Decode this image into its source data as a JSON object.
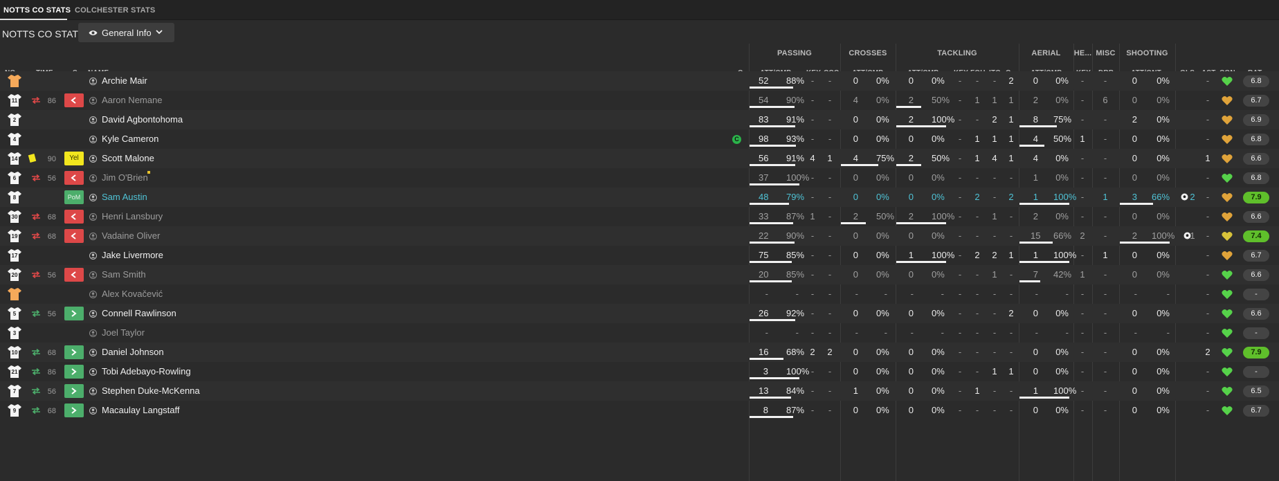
{
  "tabs": [
    {
      "label": "NOTTS CO STATS",
      "active": true
    },
    {
      "label": "COLCHESTER STATS",
      "active": false
    }
  ],
  "page_title": "NOTTS CO STATS",
  "view_selector": {
    "label": "General Info",
    "icon": "eye-icon"
  },
  "colors": {
    "sub_off": "#dd4848",
    "sub_on": "#4cae6b",
    "yellow_card": "#f2e61e",
    "pom": "#4cae6b",
    "highlight_name": "#4fc3d6",
    "rating_good": "#5fbf2b",
    "captain": "#2bb34a"
  },
  "group_headers": {
    "passing": "PASSING",
    "crosses": "CROSSES",
    "tackling": "TACKLING",
    "aerial": "AERIAL",
    "he": "HE...",
    "misc": "MISC",
    "shooting": "SHOOTING"
  },
  "columns": {
    "no": "NO.",
    "time": "TIME",
    "s": "S",
    "name": "NAME",
    "c": "C",
    "pass_att_cmp": "ATT/CMP",
    "key": "KEY",
    "ccc": "CCC",
    "cross_att_cmp": "ATT/CMP",
    "tackle_att_cmp": "ATT/CMP",
    "tackle_key": "KEY",
    "fou": "FOU",
    "itc": "ITC",
    "tackle_c": "C...",
    "aerial_att_cmp": "ATT/CMP",
    "he_key": "KEY",
    "drb": "DRB",
    "shots_att_ont": "ATT/ONT",
    "gls": "GLS",
    "ast": "AST",
    "con": "CON",
    "rat": "RAT"
  },
  "players": [
    {
      "no": "",
      "kit": "gk",
      "time": "",
      "sub": "",
      "status": "",
      "name": "Archie Mair",
      "dim": false,
      "captain": "",
      "pa": "52",
      "pp": "88%",
      "pfill": 0.88,
      "pk": "-",
      "pc": "-",
      "ca": "0",
      "cp": "0%",
      "cfill": 0,
      "ta": "0",
      "tp": "0%",
      "tfill": 0,
      "tk": "-",
      "fou": "-",
      "itc": "-",
      "tc": "2",
      "aa": "0",
      "ap": "0%",
      "afill": 0,
      "hk": "-",
      "drb": "-",
      "sa": "0",
      "sp": "0%",
      "sfill": 0,
      "gls": "",
      "ast": "-",
      "rat": "6.8",
      "good": false,
      "heart": "green"
    },
    {
      "no": "11",
      "kit": "out",
      "time": "86",
      "sub": "off",
      "status": "",
      "name": "Aaron Nemane",
      "dim": true,
      "captain": "",
      "pa": "54",
      "pp": "90%",
      "pfill": 0.9,
      "pk": "-",
      "pc": "-",
      "ca": "4",
      "cp": "0%",
      "cfill": 0,
      "ta": "2",
      "tp": "50%",
      "tfill": 0.5,
      "tk": "-",
      "fou": "1",
      "itc": "1",
      "tc": "1",
      "aa": "2",
      "ap": "0%",
      "afill": 0,
      "hk": "-",
      "drb": "6",
      "sa": "0",
      "sp": "0%",
      "sfill": 0,
      "gls": "",
      "ast": "-",
      "rat": "6.7",
      "good": false,
      "heart": "orange"
    },
    {
      "no": "2",
      "kit": "out",
      "time": "",
      "sub": "",
      "status": "",
      "name": "David Agbontohoma",
      "dim": false,
      "captain": "",
      "pa": "83",
      "pp": "91%",
      "pfill": 0.91,
      "pk": "-",
      "pc": "-",
      "ca": "0",
      "cp": "0%",
      "cfill": 0,
      "ta": "2",
      "tp": "100%",
      "tfill": 1,
      "tk": "-",
      "fou": "-",
      "itc": "2",
      "tc": "1",
      "aa": "8",
      "ap": "75%",
      "afill": 0.75,
      "hk": "-",
      "drb": "-",
      "sa": "2",
      "sp": "0%",
      "sfill": 0,
      "gls": "",
      "ast": "-",
      "rat": "6.9",
      "good": false,
      "heart": "orange"
    },
    {
      "no": "4",
      "kit": "out",
      "time": "",
      "sub": "",
      "status": "",
      "name": "Kyle Cameron",
      "dim": false,
      "captain": "C",
      "pa": "98",
      "pp": "93%",
      "pfill": 0.93,
      "pk": "-",
      "pc": "-",
      "ca": "0",
      "cp": "0%",
      "cfill": 0,
      "ta": "0",
      "tp": "0%",
      "tfill": 0,
      "tk": "-",
      "fou": "1",
      "itc": "1",
      "tc": "1",
      "aa": "4",
      "ap": "50%",
      "afill": 0.5,
      "hk": "1",
      "drb": "-",
      "sa": "0",
      "sp": "0%",
      "sfill": 0,
      "gls": "",
      "ast": "-",
      "rat": "6.8",
      "good": false,
      "heart": "orange"
    },
    {
      "no": "14",
      "kit": "out",
      "time": "90",
      "sub": "",
      "status": "Yel",
      "name": "Scott Malone",
      "dim": false,
      "captain": "",
      "pa": "56",
      "pp": "91%",
      "pfill": 0.91,
      "pk": "4",
      "pc": "1",
      "ca": "4",
      "cp": "75%",
      "cfill": 0.75,
      "ta": "2",
      "tp": "50%",
      "tfill": 0.5,
      "tk": "-",
      "fou": "1",
      "itc": "4",
      "tc": "1",
      "aa": "4",
      "ap": "0%",
      "afill": 0,
      "hk": "-",
      "drb": "-",
      "sa": "0",
      "sp": "0%",
      "sfill": 0,
      "gls": "",
      "ast": "1",
      "rat": "6.6",
      "good": false,
      "heart": "orange"
    },
    {
      "no": "6",
      "kit": "out",
      "time": "56",
      "sub": "off",
      "status": "",
      "name": "Jim O'Brien",
      "dim": true,
      "captain": "",
      "pa": "37",
      "pp": "100%",
      "pfill": 1,
      "pk": "-",
      "pc": "-",
      "ca": "0",
      "cp": "0%",
      "cfill": 0,
      "ta": "0",
      "tp": "0%",
      "tfill": 0,
      "tk": "-",
      "fou": "-",
      "itc": "-",
      "tc": "-",
      "aa": "1",
      "ap": "0%",
      "afill": 0,
      "hk": "-",
      "drb": "-",
      "sa": "0",
      "sp": "0%",
      "sfill": 0,
      "gls": "",
      "ast": "-",
      "rat": "6.8",
      "good": false,
      "heart": "green"
    },
    {
      "no": "8",
      "kit": "out",
      "time": "",
      "sub": "",
      "status": "PoM",
      "name": "Sam Austin",
      "dim": false,
      "hl": true,
      "captain": "",
      "pa": "48",
      "pp": "79%",
      "pfill": 0.79,
      "pk": "-",
      "pc": "-",
      "ca": "0",
      "cp": "0%",
      "cfill": 0,
      "ta": "0",
      "tp": "0%",
      "tfill": 0,
      "tk": "-",
      "fou": "2",
      "itc": "-",
      "tc": "2",
      "aa": "1",
      "ap": "100%",
      "afill": 1,
      "hk": "-",
      "drb": "1",
      "sa": "3",
      "sp": "66%",
      "sfill": 0.66,
      "gls": "2",
      "ast": "-",
      "rat": "7.9",
      "good": true,
      "heart": "orange"
    },
    {
      "no": "30",
      "kit": "out",
      "time": "68",
      "sub": "off",
      "status": "",
      "name": "Henri Lansbury",
      "dim": true,
      "captain": "",
      "pa": "33",
      "pp": "87%",
      "pfill": 0.87,
      "pk": "1",
      "pc": "-",
      "ca": "2",
      "cp": "50%",
      "cfill": 0.5,
      "ta": "2",
      "tp": "100%",
      "tfill": 1,
      "tk": "-",
      "fou": "-",
      "itc": "1",
      "tc": "-",
      "aa": "2",
      "ap": "0%",
      "afill": 0,
      "hk": "-",
      "drb": "-",
      "sa": "0",
      "sp": "0%",
      "sfill": 0,
      "gls": "",
      "ast": "-",
      "rat": "6.6",
      "good": false,
      "heart": "orange"
    },
    {
      "no": "19",
      "kit": "out",
      "time": "68",
      "sub": "off",
      "status": "",
      "name": "Vadaine Oliver",
      "dim": true,
      "captain": "",
      "pa": "22",
      "pp": "90%",
      "pfill": 0.9,
      "pk": "-",
      "pc": "-",
      "ca": "0",
      "cp": "0%",
      "cfill": 0,
      "ta": "0",
      "tp": "0%",
      "tfill": 0,
      "tk": "-",
      "fou": "-",
      "itc": "-",
      "tc": "-",
      "aa": "15",
      "ap": "66%",
      "afill": 0.66,
      "hk": "2",
      "drb": "-",
      "sa": "2",
      "sp": "100%",
      "sfill": 1,
      "gls": "1",
      "ast": "-",
      "rat": "7.4",
      "good": true,
      "heart": "yellow"
    },
    {
      "no": "17",
      "kit": "out",
      "time": "",
      "sub": "",
      "status": "",
      "name": "Jake Livermore",
      "dim": false,
      "captain": "",
      "pa": "75",
      "pp": "85%",
      "pfill": 0.85,
      "pk": "-",
      "pc": "-",
      "ca": "0",
      "cp": "0%",
      "cfill": 0,
      "ta": "1",
      "tp": "100%",
      "tfill": 1,
      "tk": "-",
      "fou": "2",
      "itc": "2",
      "tc": "1",
      "aa": "1",
      "ap": "100%",
      "afill": 1,
      "hk": "-",
      "drb": "1",
      "sa": "0",
      "sp": "0%",
      "sfill": 0,
      "gls": "",
      "ast": "-",
      "rat": "6.7",
      "good": false,
      "heart": "orange"
    },
    {
      "no": "20",
      "kit": "out",
      "time": "56",
      "sub": "off",
      "status": "",
      "name": "Sam Smith",
      "dim": true,
      "captain": "",
      "pa": "20",
      "pp": "85%",
      "pfill": 0.85,
      "pk": "-",
      "pc": "-",
      "ca": "0",
      "cp": "0%",
      "cfill": 0,
      "ta": "0",
      "tp": "0%",
      "tfill": 0,
      "tk": "-",
      "fou": "-",
      "itc": "1",
      "tc": "-",
      "aa": "7",
      "ap": "42%",
      "afill": 0.42,
      "hk": "1",
      "drb": "-",
      "sa": "0",
      "sp": "0%",
      "sfill": 0,
      "gls": "",
      "ast": "-",
      "rat": "6.6",
      "good": false,
      "heart": "green"
    },
    {
      "no": "",
      "kit": "gk",
      "time": "",
      "sub": "",
      "status": "",
      "name": "Alex Kovačević",
      "dim": true,
      "captain": "",
      "pa": "-",
      "pp": "-",
      "pfill": 0,
      "pk": "-",
      "pc": "-",
      "ca": "-",
      "cp": "-",
      "cfill": 0,
      "ta": "-",
      "tp": "-",
      "tfill": 0,
      "tk": "-",
      "fou": "-",
      "itc": "-",
      "tc": "-",
      "aa": "-",
      "ap": "-",
      "afill": 0,
      "hk": "-",
      "drb": "-",
      "sa": "-",
      "sp": "-",
      "sfill": 0,
      "gls": "",
      "ast": "-",
      "rat": "-",
      "good": false,
      "heart": "green"
    },
    {
      "no": "5",
      "kit": "out",
      "time": "56",
      "sub": "on",
      "status": "",
      "name": "Connell Rawlinson",
      "dim": false,
      "captain": "",
      "pa": "26",
      "pp": "92%",
      "pfill": 0.92,
      "pk": "-",
      "pc": "-",
      "ca": "0",
      "cp": "0%",
      "cfill": 0,
      "ta": "0",
      "tp": "0%",
      "tfill": 0,
      "tk": "-",
      "fou": "-",
      "itc": "-",
      "tc": "2",
      "aa": "0",
      "ap": "0%",
      "afill": 0,
      "hk": "-",
      "drb": "-",
      "sa": "0",
      "sp": "0%",
      "sfill": 0,
      "gls": "",
      "ast": "-",
      "rat": "6.6",
      "good": false,
      "heart": "green"
    },
    {
      "no": "3",
      "kit": "out",
      "time": "",
      "sub": "",
      "status": "",
      "name": "Joel Taylor",
      "dim": true,
      "captain": "",
      "pa": "-",
      "pp": "-",
      "pfill": 0,
      "pk": "-",
      "pc": "-",
      "ca": "-",
      "cp": "-",
      "cfill": 0,
      "ta": "-",
      "tp": "-",
      "tfill": 0,
      "tk": "-",
      "fou": "-",
      "itc": "-",
      "tc": "-",
      "aa": "-",
      "ap": "-",
      "afill": 0,
      "hk": "-",
      "drb": "-",
      "sa": "-",
      "sp": "-",
      "sfill": 0,
      "gls": "",
      "ast": "-",
      "rat": "-",
      "good": false,
      "heart": "green"
    },
    {
      "no": "10",
      "kit": "out",
      "time": "68",
      "sub": "on",
      "status": "",
      "name": "Daniel Johnson",
      "dim": false,
      "captain": "",
      "pa": "16",
      "pp": "68%",
      "pfill": 0.68,
      "pk": "2",
      "pc": "2",
      "ca": "0",
      "cp": "0%",
      "cfill": 0,
      "ta": "0",
      "tp": "0%",
      "tfill": 0,
      "tk": "-",
      "fou": "-",
      "itc": "-",
      "tc": "-",
      "aa": "0",
      "ap": "0%",
      "afill": 0,
      "hk": "-",
      "drb": "-",
      "sa": "0",
      "sp": "0%",
      "sfill": 0,
      "gls": "",
      "ast": "2",
      "rat": "7.9",
      "good": true,
      "heart": "green"
    },
    {
      "no": "21",
      "kit": "out",
      "time": "86",
      "sub": "on",
      "status": "",
      "name": "Tobi Adebayo-Rowling",
      "dim": false,
      "captain": "",
      "pa": "3",
      "pp": "100%",
      "pfill": 1,
      "pk": "-",
      "pc": "-",
      "ca": "0",
      "cp": "0%",
      "cfill": 0,
      "ta": "0",
      "tp": "0%",
      "tfill": 0,
      "tk": "-",
      "fou": "-",
      "itc": "1",
      "tc": "1",
      "aa": "0",
      "ap": "0%",
      "afill": 0,
      "hk": "-",
      "drb": "-",
      "sa": "0",
      "sp": "0%",
      "sfill": 0,
      "gls": "",
      "ast": "-",
      "rat": "-",
      "good": false,
      "heart": "green"
    },
    {
      "no": "7",
      "kit": "out",
      "time": "56",
      "sub": "on",
      "status": "",
      "name": "Stephen Duke-McKenna",
      "dim": false,
      "captain": "",
      "pa": "13",
      "pp": "84%",
      "pfill": 0.84,
      "pk": "-",
      "pc": "-",
      "ca": "1",
      "cp": "0%",
      "cfill": 0,
      "ta": "0",
      "tp": "0%",
      "tfill": 0,
      "tk": "-",
      "fou": "1",
      "itc": "-",
      "tc": "-",
      "aa": "1",
      "ap": "100%",
      "afill": 1,
      "hk": "-",
      "drb": "-",
      "sa": "0",
      "sp": "0%",
      "sfill": 0,
      "gls": "",
      "ast": "-",
      "rat": "6.5",
      "good": false,
      "heart": "green"
    },
    {
      "no": "9",
      "kit": "out",
      "time": "68",
      "sub": "on",
      "status": "",
      "name": "Macaulay Langstaff",
      "dim": false,
      "captain": "",
      "pa": "8",
      "pp": "87%",
      "pfill": 0.87,
      "pk": "-",
      "pc": "-",
      "ca": "0",
      "cp": "0%",
      "cfill": 0,
      "ta": "0",
      "tp": "0%",
      "tfill": 0,
      "tk": "-",
      "fou": "-",
      "itc": "-",
      "tc": "-",
      "aa": "0",
      "ap": "0%",
      "afill": 0,
      "hk": "-",
      "drb": "-",
      "sa": "0",
      "sp": "0%",
      "sfill": 0,
      "gls": "",
      "ast": "-",
      "rat": "6.7",
      "good": false,
      "heart": "green"
    }
  ]
}
